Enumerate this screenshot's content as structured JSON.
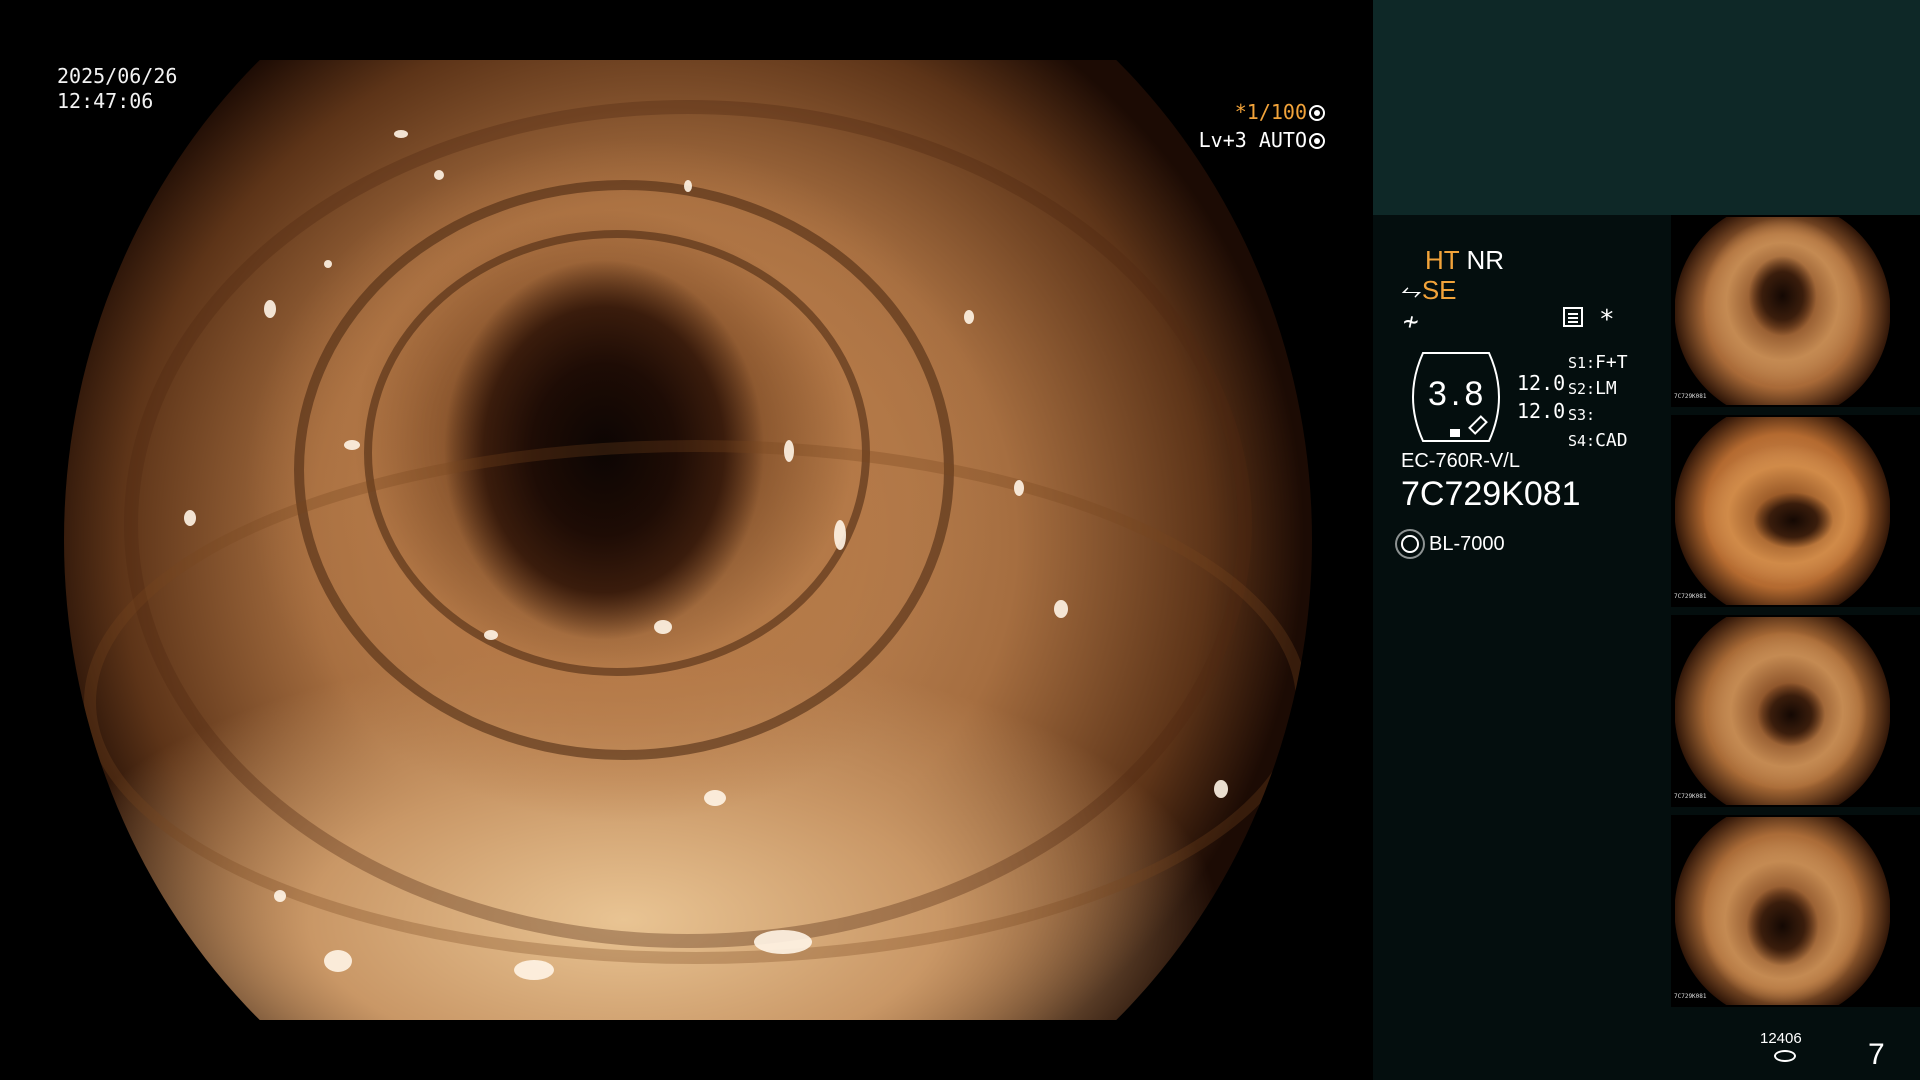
{
  "overlay": {
    "date": "2025/06/26",
    "time": "12:47:06",
    "shutter": "*1/100",
    "level": "Lv+3 AUTO"
  },
  "panel": {
    "ht": "HT",
    "nr": "NR",
    "se": "SE",
    "ratio": "3.8",
    "value_a": "12.0",
    "value_b": "12.0",
    "s1_key": "S1:",
    "s1_val": "F+T",
    "s2_key": "S2:",
    "s2_val": "LM",
    "s3_key": "S3:",
    "s3_val": "",
    "s4_key": "S4:",
    "s4_val": "CAD",
    "model": "EC-760R-V/L",
    "serial": "7C729K081",
    "light_source": "BL-7000",
    "accent_color": "#f2a33a",
    "panel_bg": "#040e0e",
    "top_box_bg": "#0e2827"
  },
  "thumbnails": [
    {
      "label": "7C729K081"
    },
    {
      "label": "7C729K081"
    },
    {
      "label": "7C729K081"
    },
    {
      "label": "7C729K081"
    }
  ],
  "footer": {
    "counter": "12406",
    "page": "7"
  }
}
